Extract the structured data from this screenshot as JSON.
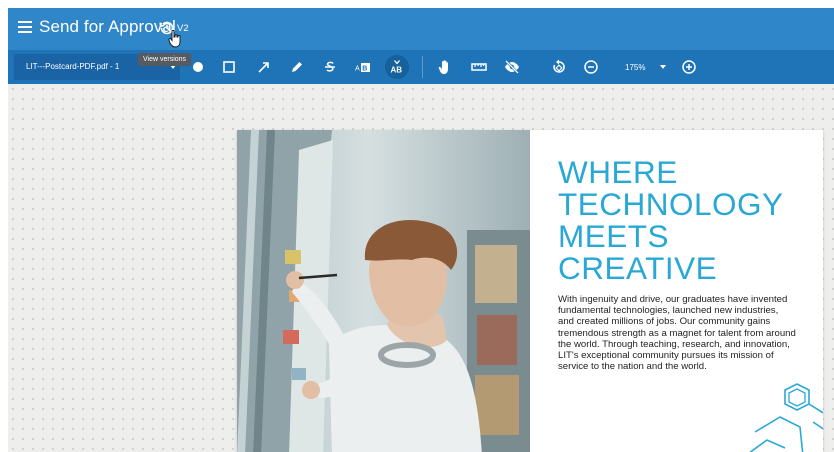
{
  "header": {
    "title": "Send for Approval",
    "version": "V2",
    "tooltip": "View versions"
  },
  "toolbar": {
    "file_name": "LIT---Postcard-PDF.pdf - 1",
    "zoom": "175%",
    "tools": [
      "circle-icon",
      "rectangle-icon",
      "arrow-icon",
      "pen-icon",
      "strikethrough-icon",
      "replace-text-icon",
      "insert-text-icon",
      "pan-hand-icon",
      "ruler-icon",
      "hide-annotations-icon",
      "rotate-icon",
      "zoom-out-icon",
      "zoom-in-icon"
    ]
  },
  "document": {
    "headline_lines": [
      "WHERE",
      "TECHNOLOGY",
      "MEETS",
      "CREATIVE"
    ],
    "body": "With ingenuity and drive, our graduates have invented fundamental technologies, launched new industries, and created millions of jobs. Our community gains tremendous strength as a magnet for talent from around the world. Through teaching, research, and innovation, LIT's exceptional community pursues its mission of service to the nation and the world."
  },
  "colors": {
    "header": "#2f86c8",
    "toolbar": "#1f73b7",
    "headline": "#29a8d6"
  }
}
